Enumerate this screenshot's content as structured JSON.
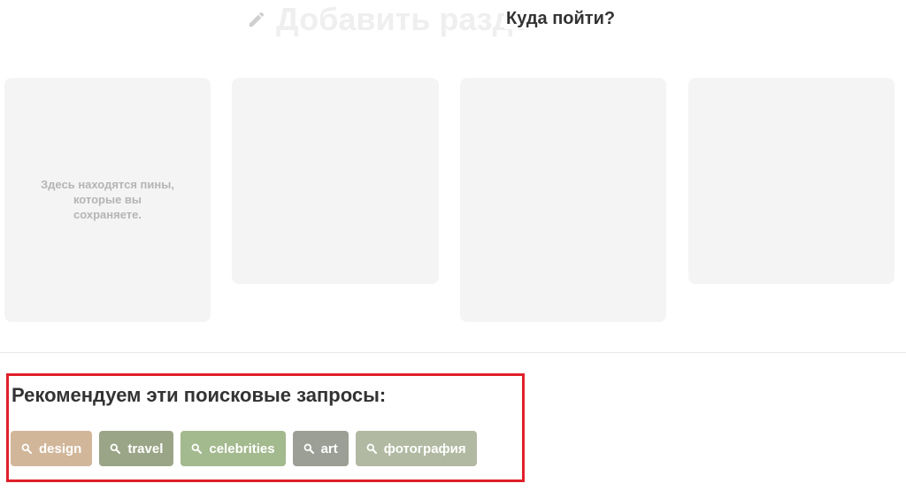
{
  "ghost_header": {
    "icon": "pencil-icon",
    "label": "Добавить разде"
  },
  "where_title": "Куда пойти?",
  "cards": [
    {
      "text": "Здесь находятся пины, которые вы сохраняете."
    },
    {
      "text": ""
    },
    {
      "text": ""
    },
    {
      "text": ""
    }
  ],
  "recommend": {
    "title": "Рекомендуем эти поисковые запросы:",
    "highlight_color": "#e0202a",
    "chips": [
      {
        "label": "design",
        "icon": "search-icon",
        "color": "#d1b69a"
      },
      {
        "label": "travel",
        "icon": "search-icon",
        "color": "#9aa587"
      },
      {
        "label": "celebrities",
        "icon": "search-icon",
        "color": "#a3b98e"
      },
      {
        "label": "art",
        "icon": "search-icon",
        "color": "#9c9f95"
      },
      {
        "label": "фотография",
        "icon": "search-icon",
        "color": "#b1b9a2"
      }
    ]
  }
}
